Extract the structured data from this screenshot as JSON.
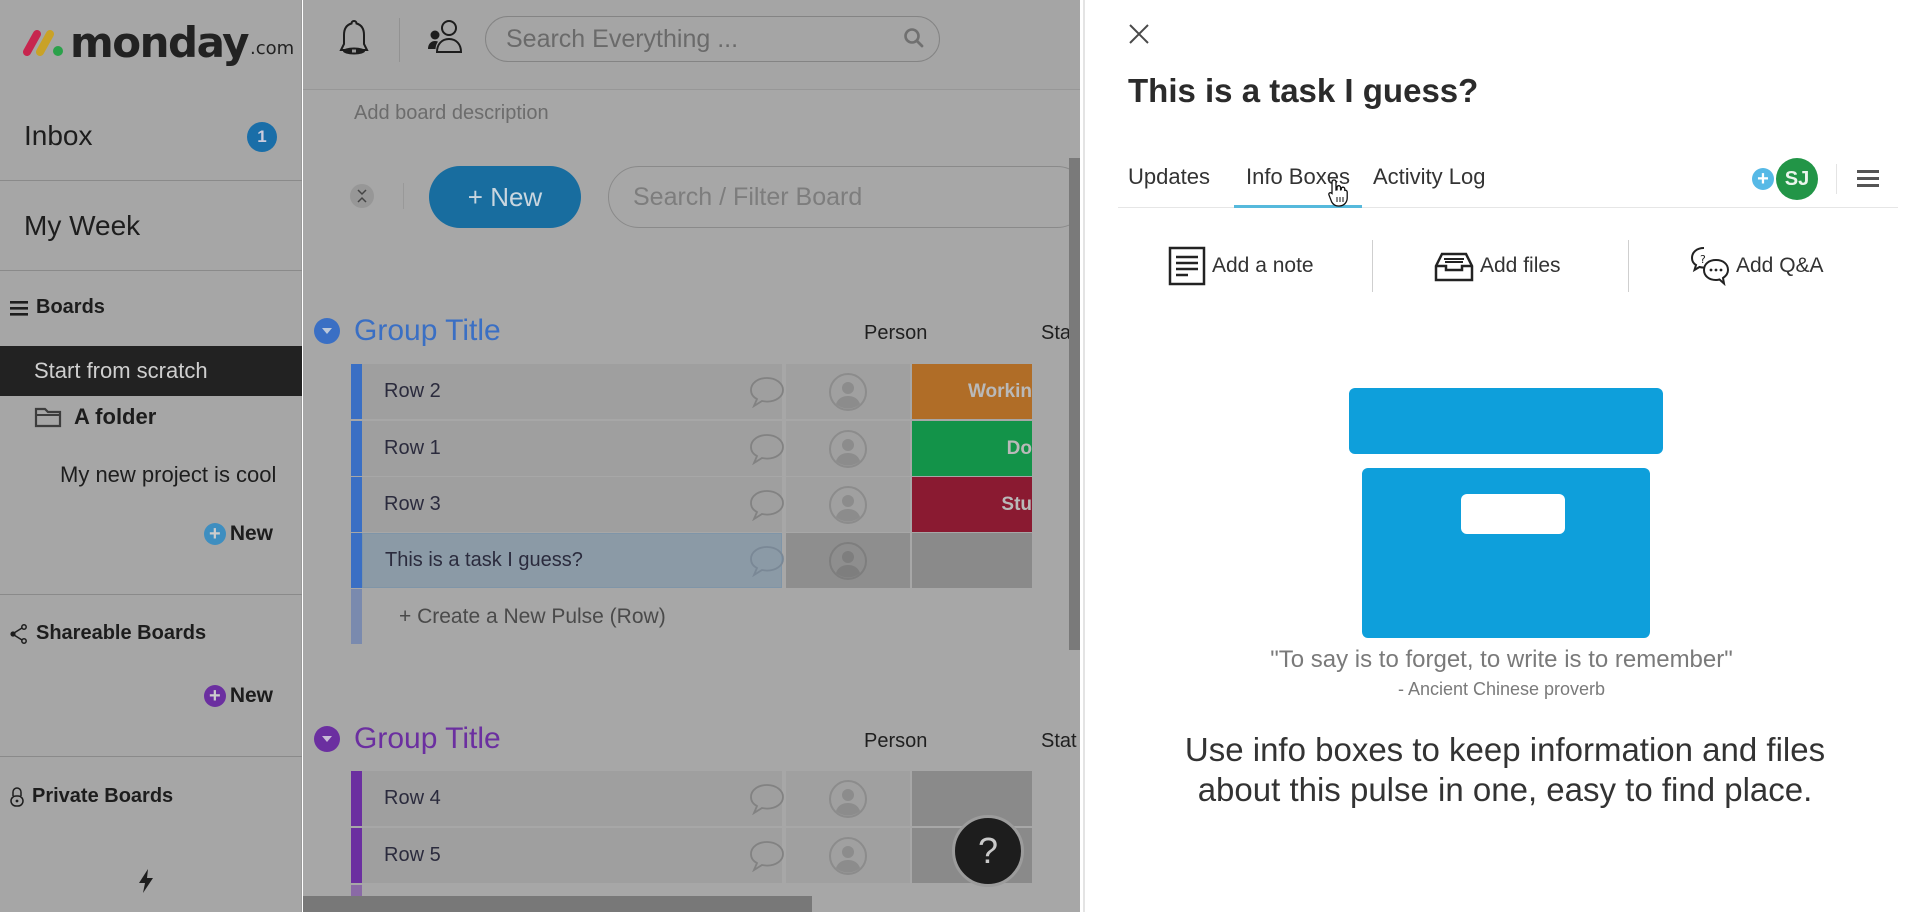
{
  "app": {
    "logo_word": "monday",
    "logo_suffix": ".com",
    "brand_colors": {
      "dash_red": "#c7254e",
      "dash_yellow": "#c9a227",
      "dot_green": "#2aa14a"
    }
  },
  "sidebar": {
    "inbox_label": "Inbox",
    "inbox_count": "1",
    "my_week_label": "My Week",
    "boards_section": {
      "icon": "hamburger-icon",
      "label": "Boards"
    },
    "start_from_scratch_label": "Start from scratch",
    "folder": {
      "icon": "folder-icon",
      "label": "A folder"
    },
    "folder_boards": [
      "My new project is cool"
    ],
    "new_board_label": "New",
    "shareable_section": {
      "icon": "share-icon",
      "label": "Shareable Boards"
    },
    "new_shareable_label": "New",
    "private_section": {
      "icon": "lock-icon",
      "label": "Private Boards"
    },
    "footer_icon": "lightning-icon"
  },
  "topbar": {
    "search_placeholder": "Search Everything ...",
    "icons": [
      "bell-icon",
      "people-icon",
      "search-icon"
    ]
  },
  "board": {
    "description_placeholder": "Add board description",
    "new_button_label": "+ New",
    "filter_placeholder": "Search / Filter Board",
    "groups": [
      {
        "title": "Group Title",
        "color": "#3a6fc4",
        "columns": {
          "person": "Person",
          "status": "Stat"
        },
        "rows": [
          {
            "name": "Row 2",
            "status": "Workin",
            "status_color": "#b06d27"
          },
          {
            "name": "Row 1",
            "status": "Do",
            "status_color": "#139349"
          },
          {
            "name": "Row 3",
            "status": "Stu",
            "status_color": "#8a1a31"
          },
          {
            "name": "This is a task I guess?",
            "status": "",
            "status_color": "#8a8a8a",
            "selected": true
          }
        ],
        "create_label": "+ Create a New Pulse (Row)"
      },
      {
        "title": "Group Title",
        "color": "#6b2fa0",
        "columns": {
          "person": "Person",
          "status": "Stat"
        },
        "rows": [
          {
            "name": "Row 4",
            "status": "",
            "status_color": "#8a8a8a"
          },
          {
            "name": "Row 5",
            "status": "",
            "status_color": "#8a8a8a"
          }
        ]
      }
    ],
    "help_label": "?"
  },
  "panel": {
    "title": "This is a task I guess?",
    "tabs": [
      {
        "label": "Updates",
        "active": false
      },
      {
        "label": "Info Boxes",
        "active": true
      },
      {
        "label": "Activity Log",
        "active": false
      }
    ],
    "subscriber_initials": "SJ",
    "subscriber_color": "#229547",
    "actions": [
      {
        "icon": "note-icon",
        "label": "Add a note"
      },
      {
        "icon": "inbox-tray-icon",
        "label": "Add files"
      },
      {
        "icon": "qa-bubbles-icon",
        "label": "Add Q&A"
      }
    ],
    "illustration_color": "#0e9fdb",
    "quote": "\"To say is to forget, to write is to remember\"",
    "quote_attribution": "- Ancient Chinese proverb",
    "blurb": "Use info boxes to keep information and files about this pulse in one, easy to find place."
  }
}
